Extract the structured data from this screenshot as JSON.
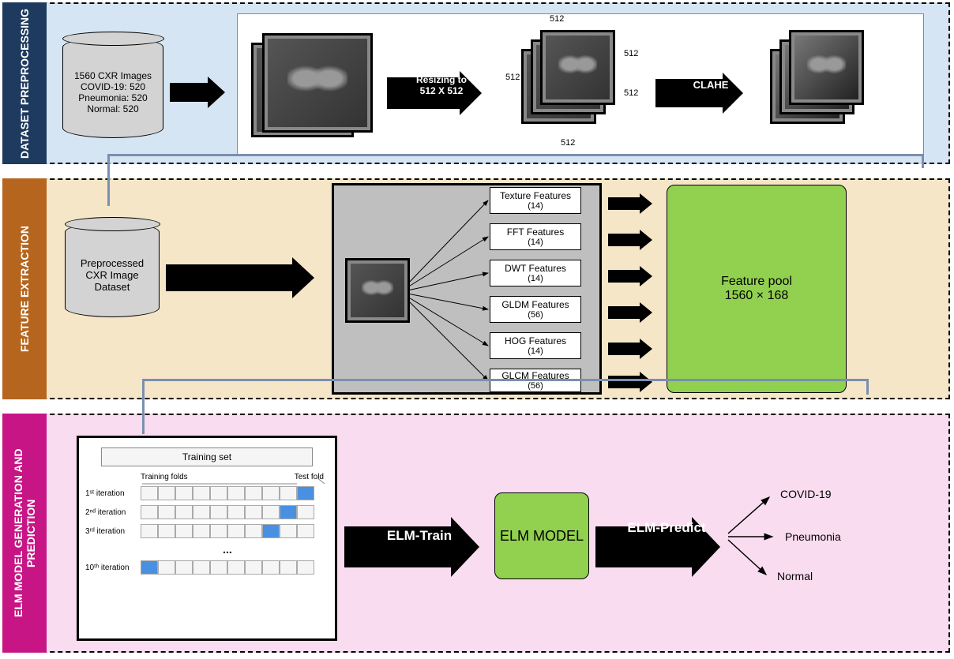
{
  "sections": {
    "s1_label": "DATASET PREPROCESSING",
    "s2_label": "FEATURE EXTRACTION",
    "s3_label": "ELM MODEL GENERATION AND PREDICTION"
  },
  "dataset_cylinder": {
    "line1": "1560 CXR Images",
    "line2": "COVID-19: 520",
    "line3": "Pneumonia: 520",
    "line4": "Normal: 520"
  },
  "resize_arrow_label": "Resizing to\n512 X 512",
  "resize_dim": "512",
  "clahe_arrow_label": "CLAHE",
  "preproc_cylinder": {
    "line1": "Preprocessed",
    "line2": "CXR Image",
    "line3": "Dataset"
  },
  "features": [
    {
      "name": "Texture Features",
      "count": "(14)"
    },
    {
      "name": "FFT Features",
      "count": "(14)"
    },
    {
      "name": "DWT Features",
      "count": "(14)"
    },
    {
      "name": "GLDM Features",
      "count": "(56)"
    },
    {
      "name": "HOG Features",
      "count": "(14)"
    },
    {
      "name": "GLCM Features",
      "count": "(56)"
    }
  ],
  "feature_pool": {
    "line1": "Feature pool",
    "line2": "1560 × 168"
  },
  "kfold": {
    "title": "Training set",
    "folds_label": "Training folds",
    "test_label": "Test fold",
    "iter1": "1ˢᵗ iteration",
    "iter2": "2ⁿᵈ iteration",
    "iter3": "3ʳᵈ iteration",
    "dots": "...",
    "iter10": "10ᵗʰ iteration"
  },
  "elm_train_label": "ELM-Train",
  "elm_model_label": "ELM MODEL",
  "elm_predict_label": "ELM-Predict",
  "outputs": {
    "covid": "COVID-19",
    "pneumonia": "Pneumonia",
    "normal": "Normal"
  }
}
